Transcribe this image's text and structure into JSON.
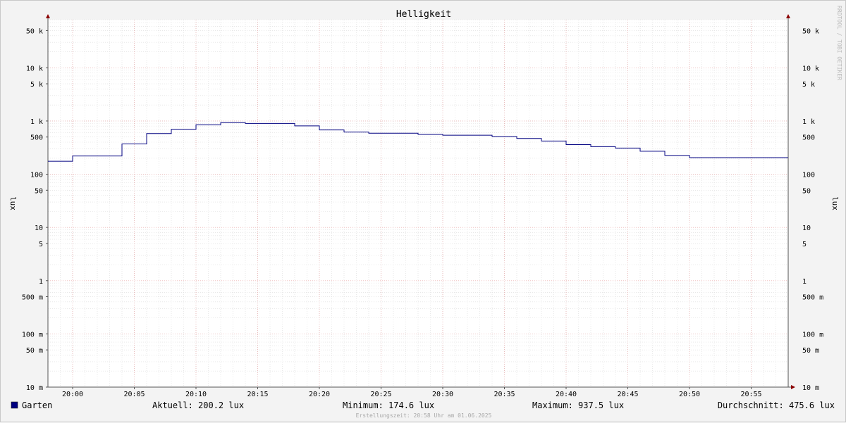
{
  "chart_data": {
    "type": "line",
    "title": "Helligkeit",
    "ylabel_left": "lux",
    "ylabel_right": "lux",
    "y_scale": "log",
    "ylim": [
      0.01,
      80000
    ],
    "xlim": [
      "19:58",
      "21:58"
    ],
    "grid": true,
    "y_ticks": [
      {
        "value": 50000,
        "label": "50 k"
      },
      {
        "value": 10000,
        "label": "10 k"
      },
      {
        "value": 5000,
        "label": "5 k"
      },
      {
        "value": 1000,
        "label": "1 k"
      },
      {
        "value": 500,
        "label": "500"
      },
      {
        "value": 100,
        "label": "100"
      },
      {
        "value": 50,
        "label": "50"
      },
      {
        "value": 10,
        "label": "10"
      },
      {
        "value": 5,
        "label": "5"
      },
      {
        "value": 1,
        "label": "1"
      },
      {
        "value": 0.5,
        "label": "500 m"
      },
      {
        "value": 0.1,
        "label": "100 m"
      },
      {
        "value": 0.05,
        "label": "50 m"
      },
      {
        "value": 0.01,
        "label": "10 m"
      }
    ],
    "x_ticks": [
      "20:00",
      "20:05",
      "20:10",
      "20:15",
      "20:20",
      "20:25",
      "20:30",
      "20:35",
      "20:40",
      "20:45",
      "20:50",
      "20:55"
    ],
    "series": [
      {
        "name": "Garten",
        "color": "#000080",
        "points": [
          {
            "t": "19:58",
            "v": 175
          },
          {
            "t": "20:00",
            "v": 220
          },
          {
            "t": "20:04",
            "v": 370
          },
          {
            "t": "20:06",
            "v": 580
          },
          {
            "t": "20:08",
            "v": 700
          },
          {
            "t": "20:10",
            "v": 850
          },
          {
            "t": "20:12",
            "v": 930
          },
          {
            "t": "20:14",
            "v": 900
          },
          {
            "t": "20:18",
            "v": 810
          },
          {
            "t": "20:20",
            "v": 680
          },
          {
            "t": "20:22",
            "v": 620
          },
          {
            "t": "20:24",
            "v": 590
          },
          {
            "t": "20:28",
            "v": 560
          },
          {
            "t": "20:30",
            "v": 540
          },
          {
            "t": "20:34",
            "v": 510
          },
          {
            "t": "20:36",
            "v": 470
          },
          {
            "t": "20:38",
            "v": 420
          },
          {
            "t": "20:40",
            "v": 360
          },
          {
            "t": "20:42",
            "v": 330
          },
          {
            "t": "20:44",
            "v": 310
          },
          {
            "t": "20:46",
            "v": 270
          },
          {
            "t": "20:48",
            "v": 225
          },
          {
            "t": "20:50",
            "v": 205
          },
          {
            "t": "20:58",
            "v": 205
          }
        ]
      }
    ]
  },
  "legend": {
    "series_name": "Garten",
    "swatch_color": "#000080",
    "current": "Aktuell: 200.2 lux",
    "minimum": "Minimum: 174.6 lux",
    "maximum": "Maximum: 937.5 lux",
    "average": "Durchschnitt: 475.6 lux"
  },
  "watermark": "RRDTOOL / TOBI OETIKER",
  "timestamp": "Erstellungszeit: 20:58 Uhr am 01.06.2025"
}
